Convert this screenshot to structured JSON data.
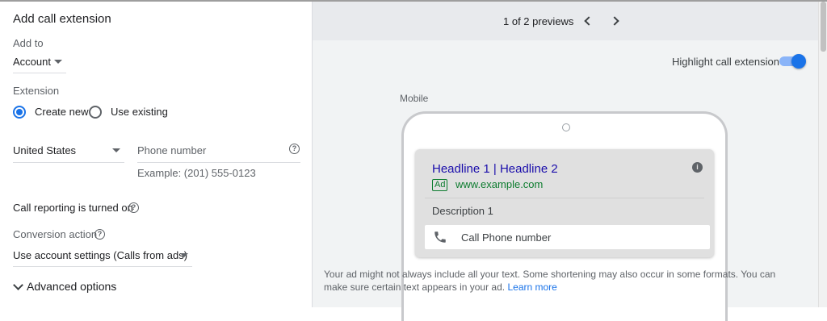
{
  "form": {
    "title": "Add call extension",
    "add_to_label": "Add to",
    "add_to_value": "Account",
    "extension_label": "Extension",
    "radio_create_new": "Create new",
    "radio_use_existing": "Use existing",
    "country_value": "United States",
    "phone_placeholder": "Phone number",
    "phone_example": "Example: (201) 555-0123",
    "call_reporting_text": "Call reporting is turned on",
    "conversion_action_label": "Conversion action",
    "conversion_action_value": "Use account settings (Calls from ads)",
    "advanced_options_label": "Advanced options"
  },
  "preview": {
    "counter": "1 of 2 previews",
    "highlight_label": "Highlight call extension",
    "highlight_on": true,
    "device_label": "Mobile",
    "ad": {
      "headline": "Headline 1 | Headline 2",
      "badge": "Ad",
      "url": "www.example.com",
      "description": "Description 1",
      "call_text": "Call Phone number"
    },
    "note": "Your ad might not always include all your text. Some shortening may also occur in some formats. You can make sure certain text appears in your ad.",
    "learn_more": "Learn more"
  },
  "colors": {
    "accent": "#1a73e8",
    "headline_link": "#1a0dab",
    "url_green": "#0d7c2f"
  }
}
